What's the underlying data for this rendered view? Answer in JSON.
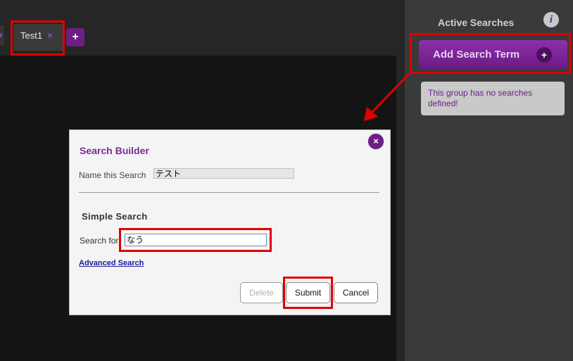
{
  "tabs": {
    "items": [
      {
        "label": "Test1",
        "close_glyph": "×"
      }
    ],
    "star_glyph": "★",
    "add_glyph": "+"
  },
  "sidebar": {
    "title": "Active Searches",
    "info_glyph": "i",
    "add_term_label": "Add Search Term",
    "add_term_glyph": "+",
    "empty_message": "This group has no searches defined!"
  },
  "dialog": {
    "title": "Search Builder",
    "close_glyph": "×",
    "name_label": "Name this Search",
    "name_value": "テスト",
    "section_title": "Simple Search",
    "search_label": "Search for",
    "search_value": "なう",
    "advanced_link": "Advanced Search",
    "buttons": {
      "delete": "Delete",
      "submit": "Submit",
      "cancel": "Cancel"
    }
  },
  "colors": {
    "accent": "#6c1f84",
    "highlight": "#e00000",
    "dialog_title": "#7b2a97"
  }
}
